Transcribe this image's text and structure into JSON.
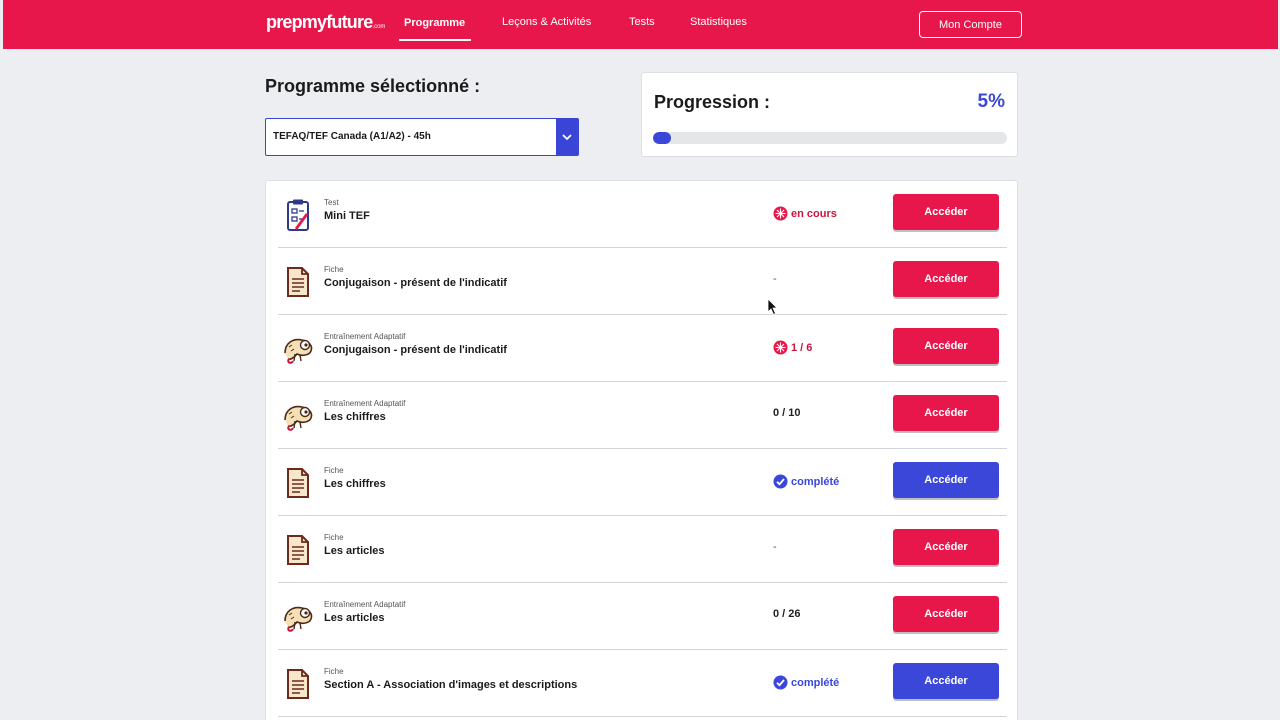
{
  "nav": {
    "logo": "prepmyfuture",
    "logo_suffix": ".com",
    "links": [
      "Programme",
      "Leçons & Activités",
      "Tests",
      "Statistiques"
    ],
    "account": "Mon Compte"
  },
  "program": {
    "title": "Programme sélectionné :",
    "selected": "TEFAQ/TEF Canada (A1/A2) - 45h"
  },
  "progress": {
    "label": "Progression :",
    "value_text": "5%",
    "fraction": 0.05
  },
  "colors": {
    "brand_red": "#e8174b",
    "accent_blue": "#3b47d9"
  },
  "items": [
    {
      "type": "Test",
      "title": "Mini TEF",
      "icon": "test-clipboard-icon",
      "status": "en cours",
      "status_style": "red-icon",
      "button": "Accéder",
      "button_color": "red"
    },
    {
      "type": "Fiche",
      "title": "Conjugaison - présent de l'indicatif",
      "icon": "document-icon",
      "status": "-",
      "status_style": "dash",
      "button": "Accéder",
      "button_color": "red"
    },
    {
      "type": "Entraînement Adaptatif",
      "title": "Conjugaison - présent de l'indicatif",
      "icon": "chameleon-icon",
      "status": "1 / 6",
      "status_style": "red-icon",
      "button": "Accéder",
      "button_color": "red"
    },
    {
      "type": "Entraînement Adaptatif",
      "title": "Les chiffres",
      "icon": "chameleon-icon",
      "status": "0 / 10",
      "status_style": "plain",
      "button": "Accéder",
      "button_color": "red"
    },
    {
      "type": "Fiche",
      "title": "Les chiffres",
      "icon": "document-icon",
      "status": "complété",
      "status_style": "blue-check",
      "button": "Accéder",
      "button_color": "blue"
    },
    {
      "type": "Fiche",
      "title": "Les articles",
      "icon": "document-icon",
      "status": "-",
      "status_style": "dash",
      "button": "Accéder",
      "button_color": "red"
    },
    {
      "type": "Entraînement Adaptatif",
      "title": "Les articles",
      "icon": "chameleon-icon",
      "status": "0 / 26",
      "status_style": "plain",
      "button": "Accéder",
      "button_color": "red"
    },
    {
      "type": "Fiche",
      "title": "Section A - Association d'images et descriptions",
      "icon": "document-icon",
      "status": "complété",
      "status_style": "blue-check",
      "button": "Accéder",
      "button_color": "blue"
    }
  ]
}
